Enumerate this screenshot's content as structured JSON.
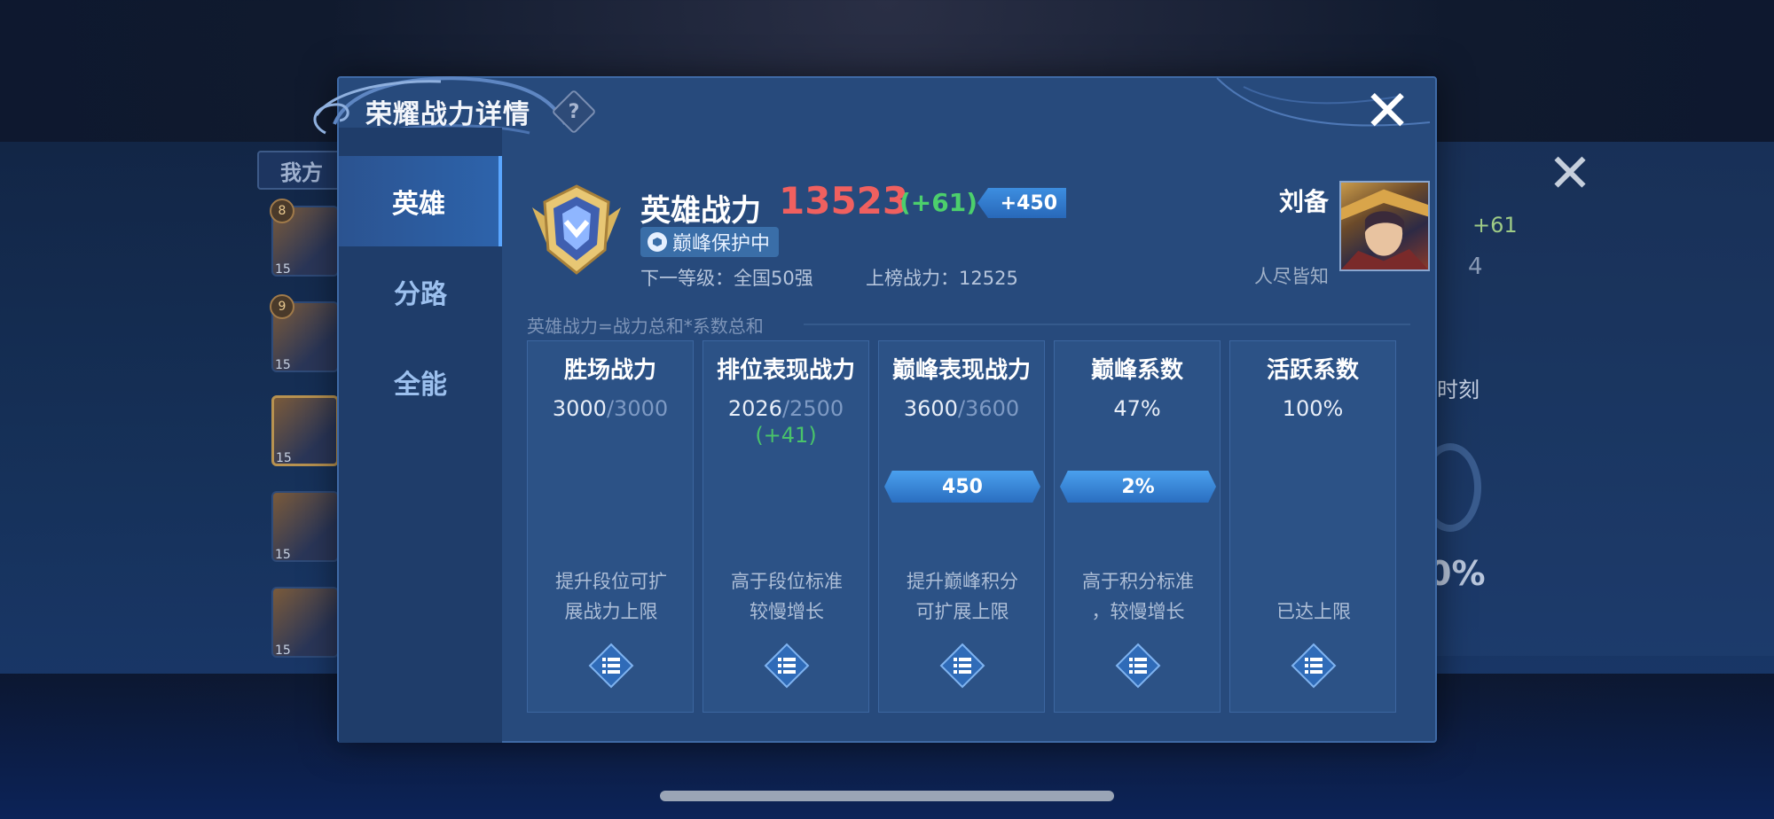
{
  "background": {
    "tab_label": "我方",
    "hero_levels": [
      "15",
      "15",
      "15",
      "15",
      "15"
    ],
    "hero_badges": [
      "8",
      "9"
    ],
    "right_delta": "+61",
    "right_count": "4",
    "right_label": "时刻",
    "right_percent": "0%"
  },
  "modal": {
    "title": "荣耀战力详情",
    "help_symbol": "?",
    "close_symbol": "✕"
  },
  "sidebar": {
    "items": [
      {
        "label": "英雄",
        "active": true
      },
      {
        "label": "分路",
        "active": false
      },
      {
        "label": "全能",
        "active": false
      }
    ]
  },
  "summary": {
    "label": "英雄战力",
    "value": "13523",
    "delta": "(+61)",
    "bonus": "+450",
    "protect_badge": "巅峰保护中",
    "next_level": "下一等级：全国50强",
    "rank_power": "上榜战力：12525",
    "hero_name": "刘备",
    "hero_title": "人尽皆知",
    "formula": "英雄战力=战力总和*系数总和"
  },
  "cards": [
    {
      "title": "胜场战力",
      "value": "3000",
      "sep": "/",
      "cap": "3000",
      "delta": "",
      "ribbon": "",
      "desc_line1": "提升段位可扩",
      "desc_line2": "展战力上限"
    },
    {
      "title": "排位表现战力",
      "value": "2026",
      "sep": "/",
      "cap": "2500",
      "delta": "(+41)",
      "ribbon": "",
      "desc_line1": "高于段位标准",
      "desc_line2": "较慢增长"
    },
    {
      "title": "巅峰表现战力",
      "value": "3600",
      "sep": "/",
      "cap": "3600",
      "delta": "",
      "ribbon": "450",
      "desc_line1": "提升巅峰积分",
      "desc_line2": "可扩展上限"
    },
    {
      "title": "巅峰系数",
      "value": "47%",
      "sep": "",
      "cap": "",
      "delta": "",
      "ribbon": "2%",
      "desc_line1": "高于积分标准",
      "desc_line2": "，较慢增长"
    },
    {
      "title": "活跃系数",
      "value": "100%",
      "sep": "",
      "cap": "",
      "delta": "",
      "ribbon": "",
      "desc_line1": "",
      "desc_line2": "已达上限"
    }
  ],
  "colors": {
    "accent": "#5aa6ff",
    "power_value": "#f0605f",
    "positive": "#4ccf6c",
    "panel": "#274a7c"
  },
  "icons": {
    "help": "question-diamond-icon",
    "close": "close-icon",
    "emblem": "rank-emblem-icon",
    "detail": "list-diamond-icon"
  }
}
